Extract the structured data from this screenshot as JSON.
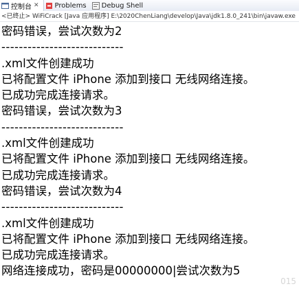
{
  "tabs": [
    {
      "label": "控制台",
      "active": true
    },
    {
      "label": "Problems",
      "active": false
    },
    {
      "label": "Debug Shell",
      "active": false
    }
  ],
  "status_text": "<已终止> WiFiCrack [Java 应用程序] E:\\2020ChenLiang\\develop\\Java\\jdk1.8.0_241\\bin\\javaw.exe（2020年",
  "console_lines": [
    "密码错误，尝试次数为2",
    "----------------------------",
    ".xml文件创建成功",
    "已将配置文件 iPhone 添加到接口 无线网络连接。",
    "已成功完成连接请求。",
    "密码错误，尝试次数为3",
    "----------------------------",
    ".xml文件创建成功",
    "已将配置文件 iPhone 添加到接口 无线网络连接。",
    "已成功完成连接请求。",
    "密码错误，尝试次数为4",
    "----------------------------",
    ".xml文件创建成功",
    "已将配置文件 iPhone 添加到接口 无线网络连接。",
    "已成功完成连接请求。",
    "网络连接成功，密码是00000000|尝试次数为5"
  ],
  "watermark": "015"
}
